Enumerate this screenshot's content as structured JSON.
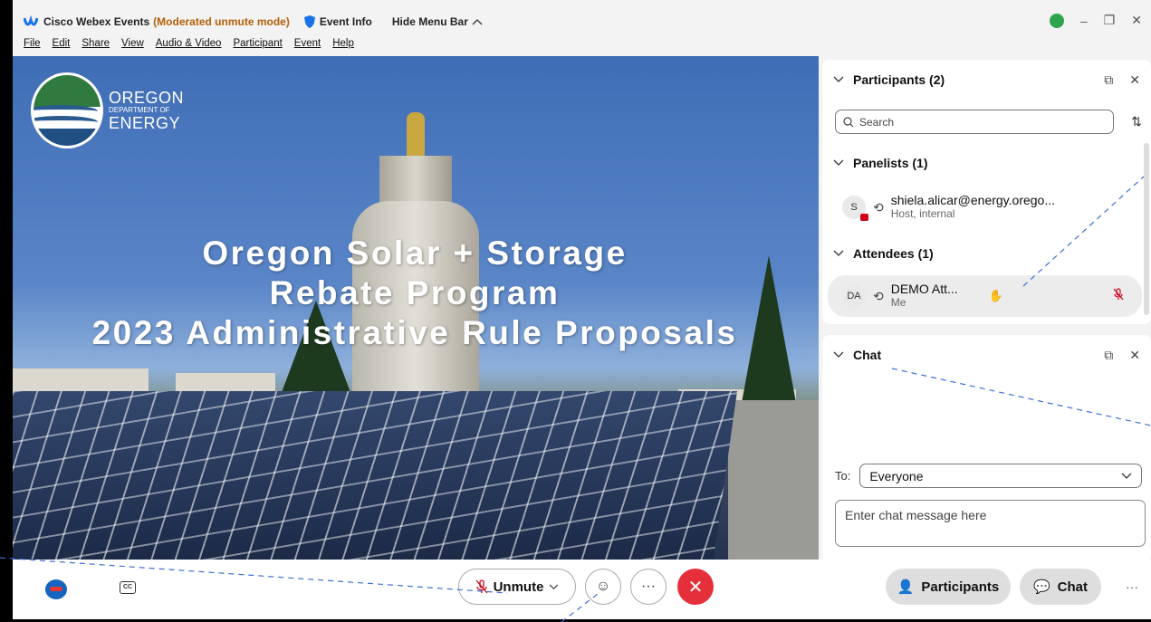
{
  "titlebar": {
    "app_name": "Cisco Webex Events",
    "mode": "(Moderated unmute mode)",
    "event_info": "Event Info",
    "hide_menu": "Hide Menu Bar"
  },
  "menu": [
    "File",
    "Edit",
    "Share",
    "View",
    "Audio & Video",
    "Participant",
    "Event",
    "Help"
  ],
  "slide": {
    "logo": {
      "line1": "OREGON",
      "line2": "DEPARTMENT OF",
      "line3": "ENERGY"
    },
    "title_lines": [
      "Oregon Solar + Storage",
      "Rebate Program",
      "2023 Administrative Rule Proposals"
    ]
  },
  "participants": {
    "header": "Participants (2)",
    "search_placeholder": "Search",
    "panelists_header": "Panelists (1)",
    "panelist": {
      "initials": "S",
      "name": "shiela.alicar@energy.orego...",
      "role": "Host, internal"
    },
    "attendees_header": "Attendees (1)",
    "attendee": {
      "initials": "DA",
      "name": "DEMO Att...",
      "role": "Me"
    }
  },
  "chat": {
    "header": "Chat",
    "to_label": "To:",
    "to_value": "Everyone",
    "input_placeholder": "Enter chat message here"
  },
  "toolbar": {
    "unmute": "Unmute",
    "participants": "Participants",
    "chat": "Chat",
    "more": "···"
  },
  "colors": {
    "mode": "#b45f06",
    "end": "#e5303b",
    "mic_muted": "#d0021b"
  }
}
